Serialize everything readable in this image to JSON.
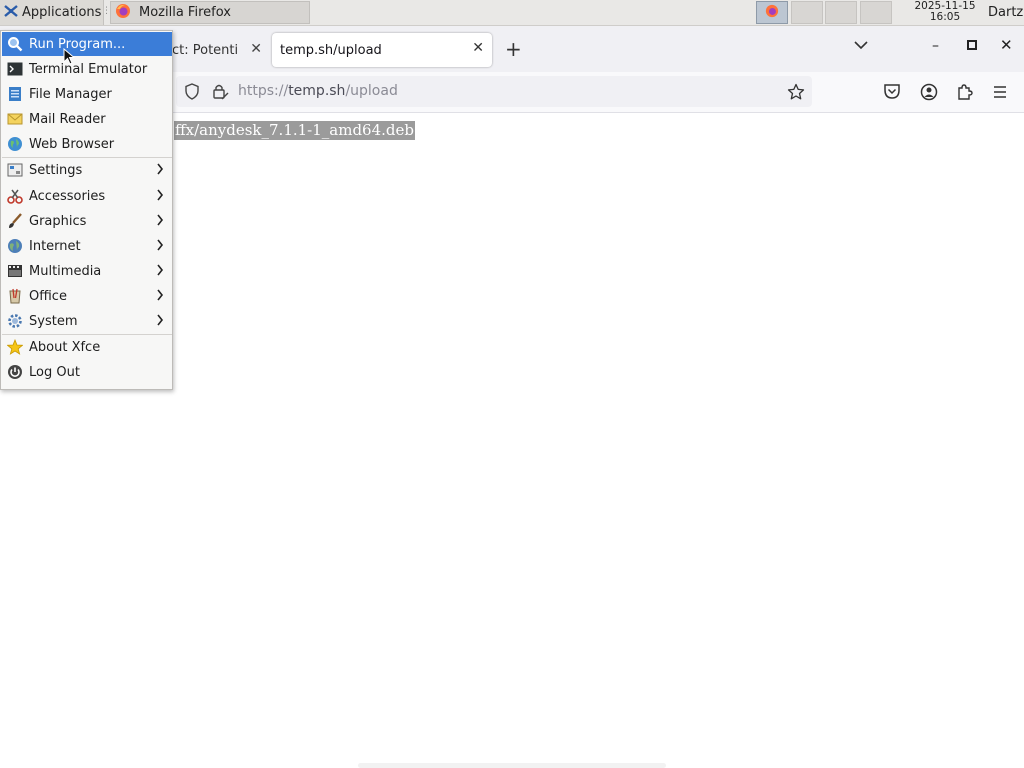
{
  "panel": {
    "applications_label": "Applications",
    "taskbar_window_label": "Mozilla Firefox",
    "clock_date": "2025-11-15",
    "clock_time": "16:05",
    "user": "Dartz"
  },
  "browser": {
    "tabs": [
      {
        "label": "ct: Potenti"
      },
      {
        "label": "temp.sh/upload"
      }
    ],
    "url_scheme": "https://",
    "url_host": "temp.sh",
    "url_path": "/upload",
    "page_text": "ffx/anydesk_7.1.1-1_amd64.deb"
  },
  "menu": {
    "items": [
      {
        "label": "Run Program...",
        "icon": "search-icon"
      },
      {
        "label": "Terminal Emulator",
        "icon": "terminal-icon"
      },
      {
        "label": "File Manager",
        "icon": "file-manager-icon"
      },
      {
        "label": "Mail Reader",
        "icon": "mail-icon"
      },
      {
        "label": "Web Browser",
        "icon": "globe-icon"
      },
      {
        "label": "Settings",
        "icon": "settings-icon"
      },
      {
        "label": "Accessories",
        "icon": "accessories-icon"
      },
      {
        "label": "Graphics",
        "icon": "brush-icon"
      },
      {
        "label": "Internet",
        "icon": "internet-icon"
      },
      {
        "label": "Multimedia",
        "icon": "film-icon"
      },
      {
        "label": "Office",
        "icon": "office-icon"
      },
      {
        "label": "System",
        "icon": "gear-icon"
      },
      {
        "label": "About Xfce",
        "icon": "star-icon"
      },
      {
        "label": "Log Out",
        "icon": "logout-icon"
      }
    ]
  },
  "colors": {
    "menu_highlight": "#3b7dd8",
    "selection": "#9b9b9b"
  }
}
